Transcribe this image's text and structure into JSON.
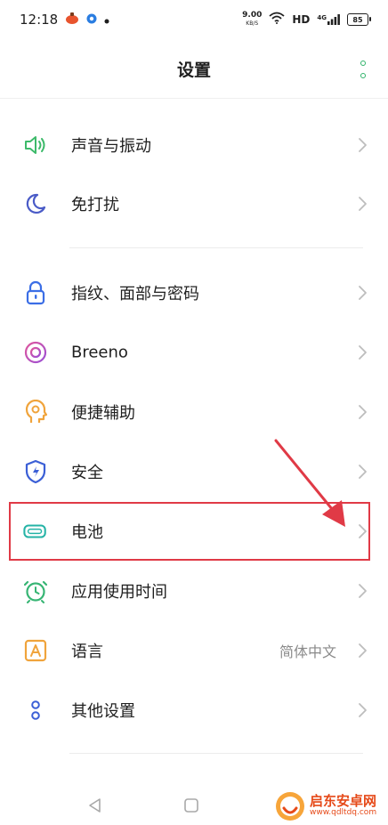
{
  "status_bar": {
    "time": "12:18",
    "net_speed_value": "9.00",
    "net_speed_unit": "KB/S",
    "hd": "HD",
    "signal": "4G",
    "battery": "85",
    "icons": [
      "app-notification-icon",
      "browser-notification-icon",
      "dot-icon",
      "wifi-icon",
      "signal-icon",
      "battery-icon"
    ]
  },
  "header": {
    "title": "设置",
    "more_icon": "more-vertical-icon",
    "accent_color": "#2fb36a"
  },
  "settings": [
    {
      "id": "sound",
      "label": "声音与振动",
      "icon": "speaker-icon",
      "color": "#3dba6a",
      "value": ""
    },
    {
      "id": "dnd",
      "label": "免打扰",
      "icon": "moon-icon",
      "color": "#4a5bc7",
      "value": ""
    },
    {
      "id": "security-fingerprint",
      "label": "指纹、面部与密码",
      "icon": "lock-icon",
      "color": "#3b6ee6",
      "value": ""
    },
    {
      "id": "breeno",
      "label": "Breeno",
      "icon": "breeno-icon",
      "color": "#c94fb8",
      "value": ""
    },
    {
      "id": "accessibility",
      "label": "便捷辅助",
      "icon": "accessibility-icon",
      "color": "#f0a43c",
      "value": ""
    },
    {
      "id": "safety",
      "label": "安全",
      "icon": "shield-icon",
      "color": "#3b5fd6",
      "value": ""
    },
    {
      "id": "battery",
      "label": "电池",
      "icon": "battery-icon",
      "color": "#24b3a6",
      "value": ""
    },
    {
      "id": "app-usage",
      "label": "应用使用时间",
      "icon": "alarm-clock-icon",
      "color": "#37b574",
      "value": ""
    },
    {
      "id": "language",
      "label": "语言",
      "icon": "language-icon",
      "color": "#f0a43c",
      "value": "简体中文"
    },
    {
      "id": "other",
      "label": "其他设置",
      "icon": "other-settings-icon",
      "color": "#3b5fd6",
      "value": ""
    }
  ],
  "highlight_color": "#e03a46",
  "nav_bar": {
    "back_icon": "back-icon",
    "home_icon": "home-icon"
  },
  "watermark": {
    "title": "启东安卓网",
    "url": "www.qdltdq.com"
  }
}
